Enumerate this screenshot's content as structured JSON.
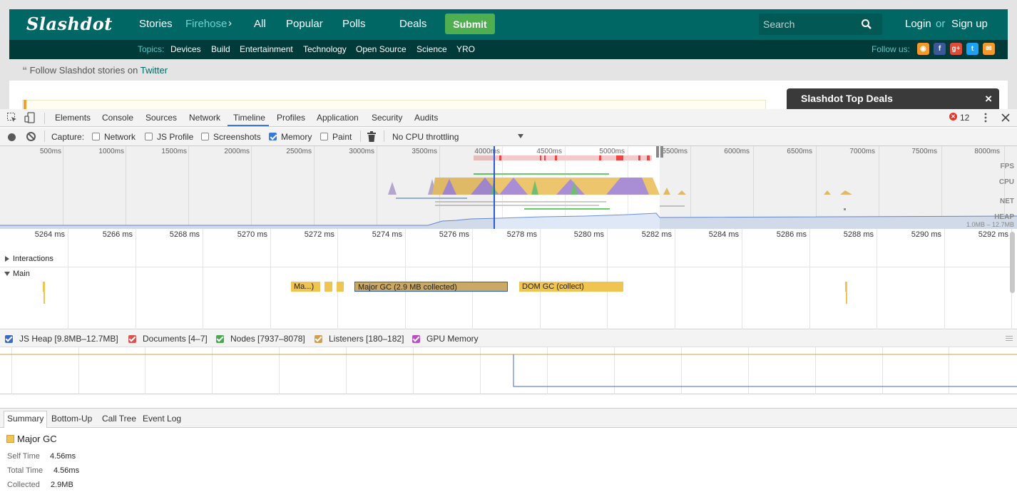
{
  "site": {
    "logo": "Slashdot",
    "nav": [
      "Stories",
      "Firehose",
      "All",
      "Popular",
      "Polls",
      "Deals"
    ],
    "submit": "Submit",
    "search_placeholder": "Search",
    "login": "Login",
    "or": "or",
    "signup": "Sign up",
    "topics_label": "Topics:",
    "topics": [
      "Devices",
      "Build",
      "Entertainment",
      "Technology",
      "Open Source",
      "Science",
      "YRO"
    ],
    "follow_label": "Follow us:",
    "twitter_text": "Follow Slashdot stories on",
    "twitter_link": "Twitter",
    "deals_title": "Slashdot Top Deals",
    "deals_close": "×",
    "colors": {
      "header": "#016765",
      "subheader": "#003a39",
      "submit": "#4fae4f"
    }
  },
  "devtools": {
    "tabs": [
      "Elements",
      "Console",
      "Sources",
      "Network",
      "Timeline",
      "Profiles",
      "Application",
      "Security",
      "Audits"
    ],
    "active_tab": "Timeline",
    "error_count": "12",
    "toolbar": {
      "capture_label": "Capture:",
      "options": [
        {
          "label": "Network",
          "checked": false
        },
        {
          "label": "JS Profile",
          "checked": false
        },
        {
          "label": "Screenshots",
          "checked": false
        },
        {
          "label": "Memory",
          "checked": true
        },
        {
          "label": "Paint",
          "checked": false
        }
      ],
      "throttling": "No CPU throttling"
    },
    "overview": {
      "ticks": [
        "500ms",
        "1000ms",
        "1500ms",
        "2000ms",
        "2500ms",
        "3000ms",
        "3500ms",
        "4000ms",
        "4500ms",
        "5000ms",
        "5500ms",
        "6000ms",
        "6500ms",
        "7000ms",
        "7500ms",
        "8000ms"
      ],
      "tracks": [
        "FPS",
        "CPU",
        "NET",
        "HEAP"
      ],
      "heap_range": "1.0MB – 12.7MB"
    },
    "ruler": [
      "5264 ms",
      "5266 ms",
      "5268 ms",
      "5270 ms",
      "5272 ms",
      "5274 ms",
      "5276 ms",
      "5278 ms",
      "5280 ms",
      "5282 ms",
      "5284 ms",
      "5286 ms",
      "5288 ms",
      "5290 ms",
      "5292 ms"
    ],
    "tracks": {
      "interactions": "Interactions",
      "main": "Main"
    },
    "events": {
      "ma": "Ma...)",
      "major_gc": "Major GC (2.9 MB collected)",
      "dom_gc": "DOM GC (collect)"
    },
    "counters": [
      {
        "label": "JS Heap [9.8MB–12.7MB]",
        "color": "#3c69c8"
      },
      {
        "label": "Documents [4–7]",
        "color": "#d9534f"
      },
      {
        "label": "Nodes [7937–8078]",
        "color": "#4aa850"
      },
      {
        "label": "Listeners [180–182]",
        "color": "#d0a050"
      },
      {
        "label": "GPU Memory",
        "color": "#b84fc4"
      }
    ],
    "bottom_tabs": [
      "Summary",
      "Bottom-Up",
      "Call Tree",
      "Event Log"
    ],
    "summary": {
      "title": "Major GC",
      "rows": [
        {
          "key": "Self Time",
          "value": "4.56ms"
        },
        {
          "key": "Total Time",
          "value": "4.56ms"
        },
        {
          "key": "Collected",
          "value": "2.9MB"
        }
      ]
    }
  }
}
